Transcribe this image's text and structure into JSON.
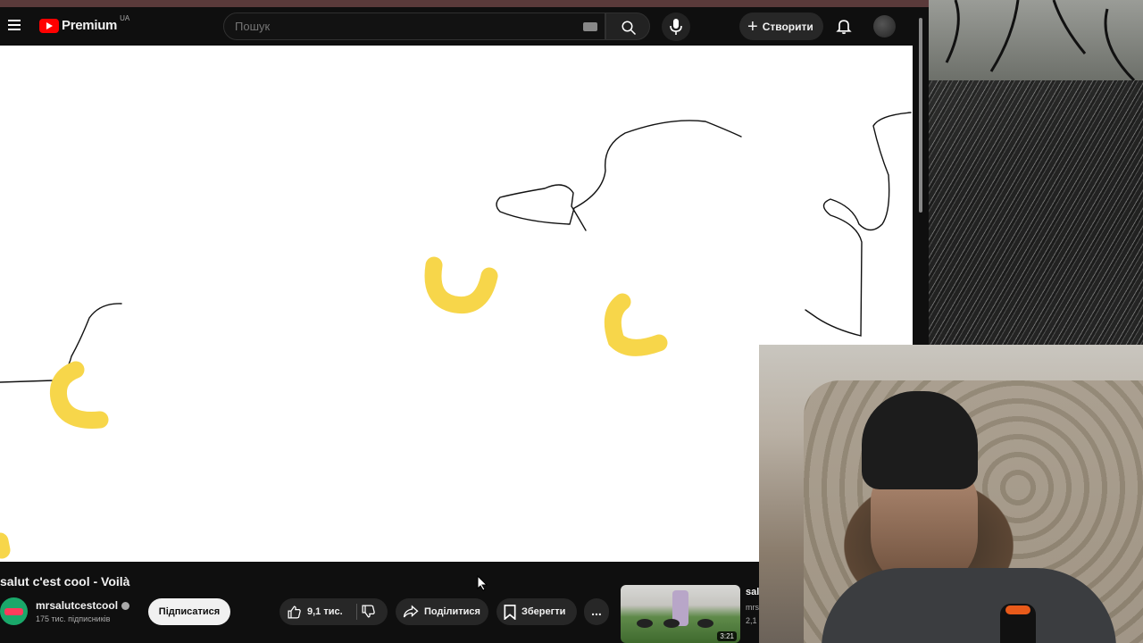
{
  "masthead": {
    "logo_text": "Premium",
    "logo_country": "UA",
    "search_placeholder": "Пошук",
    "create_label": "Створити",
    "icons": [
      "menu-icon",
      "youtube-logo-icon",
      "keyboard-icon",
      "search-icon",
      "mic-icon",
      "plus-icon",
      "bell-icon"
    ]
  },
  "video": {
    "title": "salut c'est cool - Voilà",
    "channel_name": "mrsalutcestcool",
    "channel_subscribers": "175 тис. підписників",
    "subscribe_label": "Підписатися",
    "likes_label": "9,1 тис.",
    "share_label": "Поділитися",
    "save_label": "Зберегти",
    "more_label": "..."
  },
  "recommended": {
    "title": "sal",
    "channel": "mrs",
    "views": "2,1",
    "duration": "3:21"
  },
  "colors": {
    "background": "#0f0f0f",
    "drawing_ink": "#111111",
    "drawing_yellow": "#f7d64a",
    "brand_red": "#ff0000"
  }
}
